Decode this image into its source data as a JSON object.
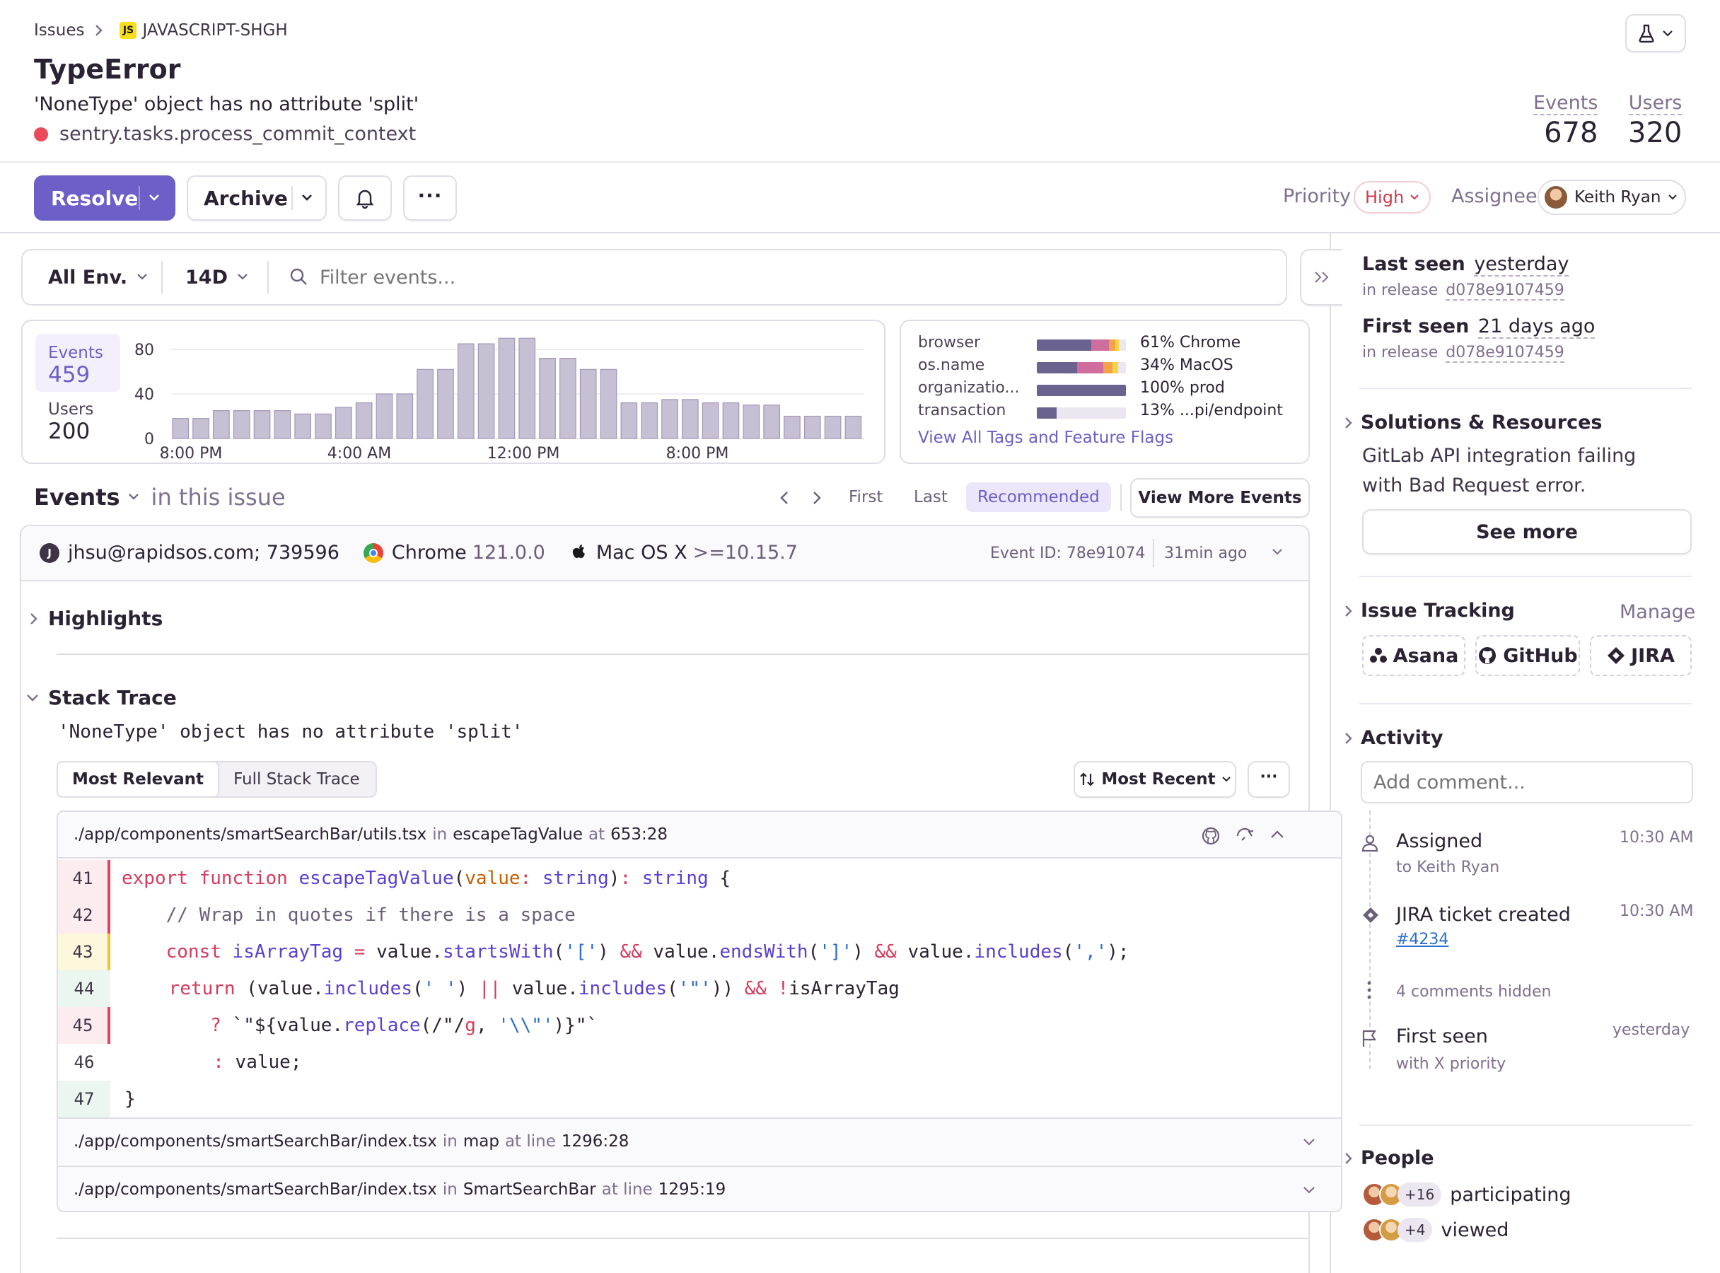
{
  "breadcrumb": {
    "root": "Issues",
    "project_badge": "JS",
    "project": "JAVASCRIPT-SHGH"
  },
  "issue": {
    "title": "TypeError",
    "message": "'NoneType' object has no attribute 'split'",
    "culprit": "sentry.tasks.process_commit_context"
  },
  "stats": {
    "events_label": "Events",
    "events_value": "678",
    "users_label": "Users",
    "users_value": "320"
  },
  "toolbar": {
    "resolve": "Resolve",
    "archive": "Archive",
    "more": "···",
    "priority_label": "Priority",
    "priority_value": "High",
    "assignee_label": "Assignee",
    "assignee_value": "Keith Ryan"
  },
  "filters": {
    "env": "All Env.",
    "period": "14D",
    "search_placeholder": "Filter events..."
  },
  "chart_card": {
    "events_label": "Events",
    "events_value": "459",
    "users_label": "Users",
    "users_value": "200"
  },
  "chart_data": {
    "type": "bar",
    "x_ticks": [
      "8:00 PM",
      "4:00 AM",
      "12:00 PM",
      "8:00 PM"
    ],
    "y_ticks": [
      "80",
      "40",
      "0"
    ],
    "ylim": [
      0,
      80
    ],
    "values": [
      18,
      18,
      25,
      25,
      25,
      25,
      22,
      22,
      28,
      32,
      40,
      40,
      62,
      62,
      85,
      85,
      90,
      90,
      72,
      72,
      62,
      62,
      32,
      32,
      35,
      35,
      32,
      32,
      30,
      30,
      20,
      20,
      20,
      20
    ],
    "grid": true,
    "bar_color": "#c7bfd4"
  },
  "tags": {
    "rows": [
      {
        "key": "browser",
        "value": "61% Chrome",
        "fill": 0.61,
        "segments": [
          0.61,
          0.2,
          0.07,
          0.04
        ]
      },
      {
        "key": "os.name",
        "value": "34% MacOS",
        "fill": 0.34,
        "segments": [
          0.45,
          0.3,
          0.1,
          0.06
        ]
      },
      {
        "key": "organizatio...",
        "value": "100% prod",
        "fill": 1.0,
        "segments": [
          1.0
        ]
      },
      {
        "key": "transaction",
        "value": "13% ...pi/endpoint",
        "fill": 0.13,
        "segments": [
          0.22
        ]
      }
    ],
    "link": "View All Tags and Feature Flags",
    "colors": {
      "main": "#6a6390",
      "pink": "#cf6e9e",
      "orange": "#f1a34a",
      "yellow": "#f5d343",
      "bg": "#ebe6ef"
    }
  },
  "events_header": {
    "title": "Events",
    "subtitle": "in this issue",
    "first": "First",
    "last": "Last",
    "recommended": "Recommended",
    "view_more": "View More Events"
  },
  "event_meta": {
    "user_initial": "J",
    "user": "jhsu@rapidsos.com; 739596",
    "browser": "Chrome",
    "browser_version": "121.0.0",
    "os": "Mac OS X",
    "os_version": ">=10.15.7",
    "event_id": "Event ID: 78e91074",
    "age": "31min ago"
  },
  "highlights": {
    "title": "Highlights"
  },
  "stack": {
    "title": "Stack Trace",
    "exception": "'NoneType' object has no attribute 'split'",
    "tab_relevant": "Most Relevant",
    "tab_full": "Full Stack Trace",
    "sort": "Most Recent",
    "frame1": {
      "path": "./app/components/smartSearchBar/utils.tsx",
      "in": "in",
      "fn": "escapeTagValue",
      "at": "at",
      "loc": "653:28"
    },
    "lines": [
      "41",
      "42",
      "43",
      "44",
      "45",
      "46",
      "47"
    ],
    "frame2": {
      "path": "./app/components/smartSearchBar/index.tsx",
      "in": "in",
      "fn": "map",
      "at": "at line",
      "loc": "1296:28"
    },
    "frame3": {
      "path": "./app/components/smartSearchBar/index.tsx",
      "in": "in",
      "fn": "SmartSearchBar",
      "at": "at line",
      "loc": "1295:19"
    }
  },
  "sidebar": {
    "last_seen_label": "Last seen",
    "last_seen_value": "yesterday",
    "release_label": "in release",
    "release_value": "d078e9107459",
    "first_seen_label": "First seen",
    "first_seen_value": "21 days ago",
    "release2_label": "in release",
    "release2_value": "d078e9107459",
    "solutions_title": "Solutions & Resources",
    "solutions_text": "GitLab API integration failing with Bad Request error.",
    "see_more": "See more",
    "tracking_title": "Issue Tracking",
    "manage": "Manage",
    "asana": "Asana",
    "github": "GitHub",
    "jira": "JIRA",
    "activity_title": "Activity",
    "comment_placeholder": "Add comment...",
    "act1_title": "Assigned",
    "act1_sub": "to Keith Ryan",
    "act1_time": "10:30 AM",
    "act2_title": "JIRA ticket created",
    "act2_sub": "#4234",
    "act2_time": "10:30 AM",
    "hidden": "4 comments hidden",
    "act3_title": "First seen",
    "act3_sub": "with X priority",
    "act3_time": "yesterday",
    "people_title": "People",
    "part_count": "+16",
    "part_label": "participating",
    "view_count": "+4",
    "view_label": "viewed"
  }
}
